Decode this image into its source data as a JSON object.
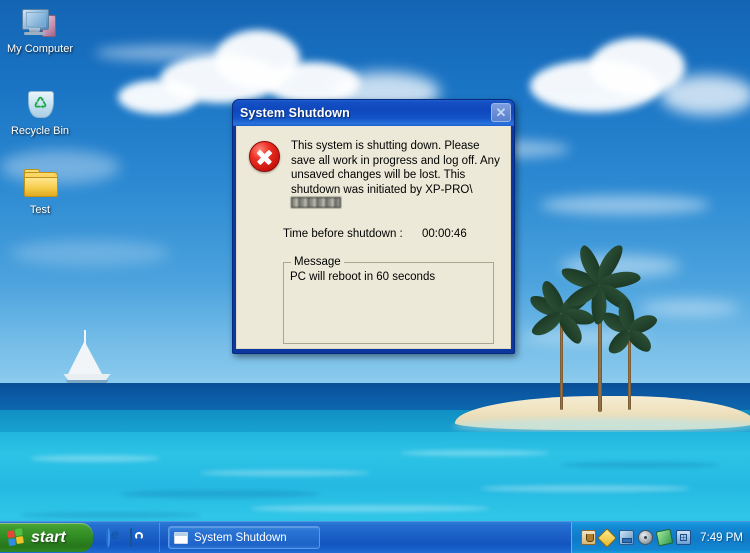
{
  "desktop": {
    "icons": [
      {
        "label": "My Computer",
        "icon": "my-computer-icon"
      },
      {
        "label": "Recycle Bin",
        "icon": "recycle-bin-icon"
      },
      {
        "label": "Test",
        "icon": "folder-icon"
      }
    ],
    "wallpaper_description": "Tropical beach with sailboat, island and palm trees"
  },
  "dialog": {
    "title": "System Shutdown",
    "close_label": "✕",
    "error_icon": "error-icon",
    "message": "This system is shutting down. Please save all work in progress and log off. Any unsaved changes will be lost. This shutdown was initiated by XP-PRO\\",
    "message_redacted_user": "",
    "timer_label": "Time before shutdown :",
    "timer_value": "00:00:46",
    "groupbox_legend": "Message",
    "groupbox_message": "PC will reboot in 60 seconds"
  },
  "taskbar": {
    "start_label": "start",
    "quick_launch": [
      {
        "name": "internet-explorer-icon"
      },
      {
        "name": "browser-refresh-icon"
      }
    ],
    "buttons": [
      {
        "label": "System Shutdown",
        "icon": "window-icon",
        "active": true
      }
    ],
    "tray_icons": [
      {
        "name": "java-icon"
      },
      {
        "name": "yellow-diamond-icon"
      },
      {
        "name": "network-connection-icon"
      },
      {
        "name": "disc-icon"
      },
      {
        "name": "green-shield-icon"
      },
      {
        "name": "grid-icon"
      }
    ],
    "clock": "7:49 PM"
  },
  "colors": {
    "titlebar_blue": "#0f47bd",
    "dialog_border": "#0a38a0",
    "client_bg": "#ece9d8",
    "taskbar_blue": "#1b5fc6",
    "start_green": "#2f8a22",
    "error_red": "#c4120c"
  }
}
